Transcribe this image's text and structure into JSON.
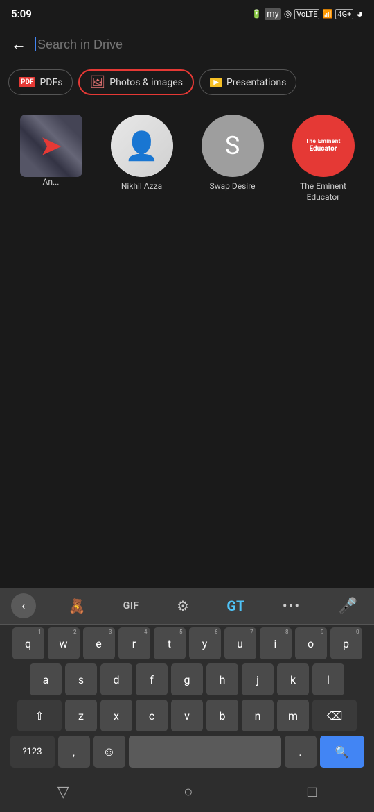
{
  "statusBar": {
    "time": "5:09",
    "icons": [
      "battery",
      "my-icon",
      "cast",
      "lte",
      "signal",
      "4g",
      "circle"
    ]
  },
  "searchBar": {
    "placeholder": "Search in Drive",
    "backLabel": "←"
  },
  "filters": [
    {
      "id": "pdfs",
      "label": "PDFs",
      "icon": "pdf",
      "active": false
    },
    {
      "id": "photos",
      "label": "Photos & images",
      "icon": "photo",
      "active": true
    },
    {
      "id": "presentations",
      "label": "Presentations",
      "icon": "slides",
      "active": false
    }
  ],
  "gridItems": [
    {
      "id": "item-1",
      "type": "image",
      "label": "An..."
    },
    {
      "id": "item-2",
      "type": "avatar-photo",
      "label": "Nikhil Azza",
      "name": "Nikhil Azza"
    },
    {
      "id": "item-3",
      "type": "avatar-letter",
      "label": "Swap Desire",
      "letter": "S"
    },
    {
      "id": "item-4",
      "type": "avatar-educator",
      "label": "The Eminent\nEducator",
      "topText": "The Eminent",
      "bottomText": "Educator"
    }
  ],
  "keyboard": {
    "toolbar": {
      "chevronLabel": "‹",
      "smileyLabel": "☺",
      "gifLabel": "GIF",
      "gearLabel": "⚙",
      "translateLabel": "GT",
      "moreLabel": "•••",
      "micLabel": "🎤"
    },
    "rows": [
      {
        "keys": [
          {
            "label": "q",
            "number": "1"
          },
          {
            "label": "w",
            "number": "2"
          },
          {
            "label": "e",
            "number": "3"
          },
          {
            "label": "r",
            "number": "4"
          },
          {
            "label": "t",
            "number": "5"
          },
          {
            "label": "y",
            "number": "6"
          },
          {
            "label": "u",
            "number": "7"
          },
          {
            "label": "i",
            "number": "8"
          },
          {
            "label": "o",
            "number": "9"
          },
          {
            "label": "p",
            "number": "0"
          }
        ]
      },
      {
        "keys": [
          {
            "label": "a"
          },
          {
            "label": "s"
          },
          {
            "label": "d"
          },
          {
            "label": "f"
          },
          {
            "label": "g"
          },
          {
            "label": "h"
          },
          {
            "label": "j"
          },
          {
            "label": "k"
          },
          {
            "label": "l"
          }
        ]
      },
      {
        "keys": [
          {
            "label": "⇧",
            "wide": true,
            "gray": true
          },
          {
            "label": "z"
          },
          {
            "label": "x"
          },
          {
            "label": "c"
          },
          {
            "label": "v"
          },
          {
            "label": "b"
          },
          {
            "label": "n"
          },
          {
            "label": "m"
          },
          {
            "label": "⌫",
            "wide": true,
            "gray": true
          }
        ]
      },
      {
        "keys": [
          {
            "label": "?123",
            "wide": true,
            "gray": true,
            "symbol": true
          },
          {
            "label": ","
          },
          {
            "label": "☺",
            "emoji": true
          },
          {
            "label": "",
            "space": true
          },
          {
            "label": "."
          },
          {
            "label": "🔍",
            "action": true,
            "wide": true
          }
        ]
      }
    ],
    "navBar": {
      "back": "▽",
      "home": "○",
      "recent": "□"
    }
  }
}
